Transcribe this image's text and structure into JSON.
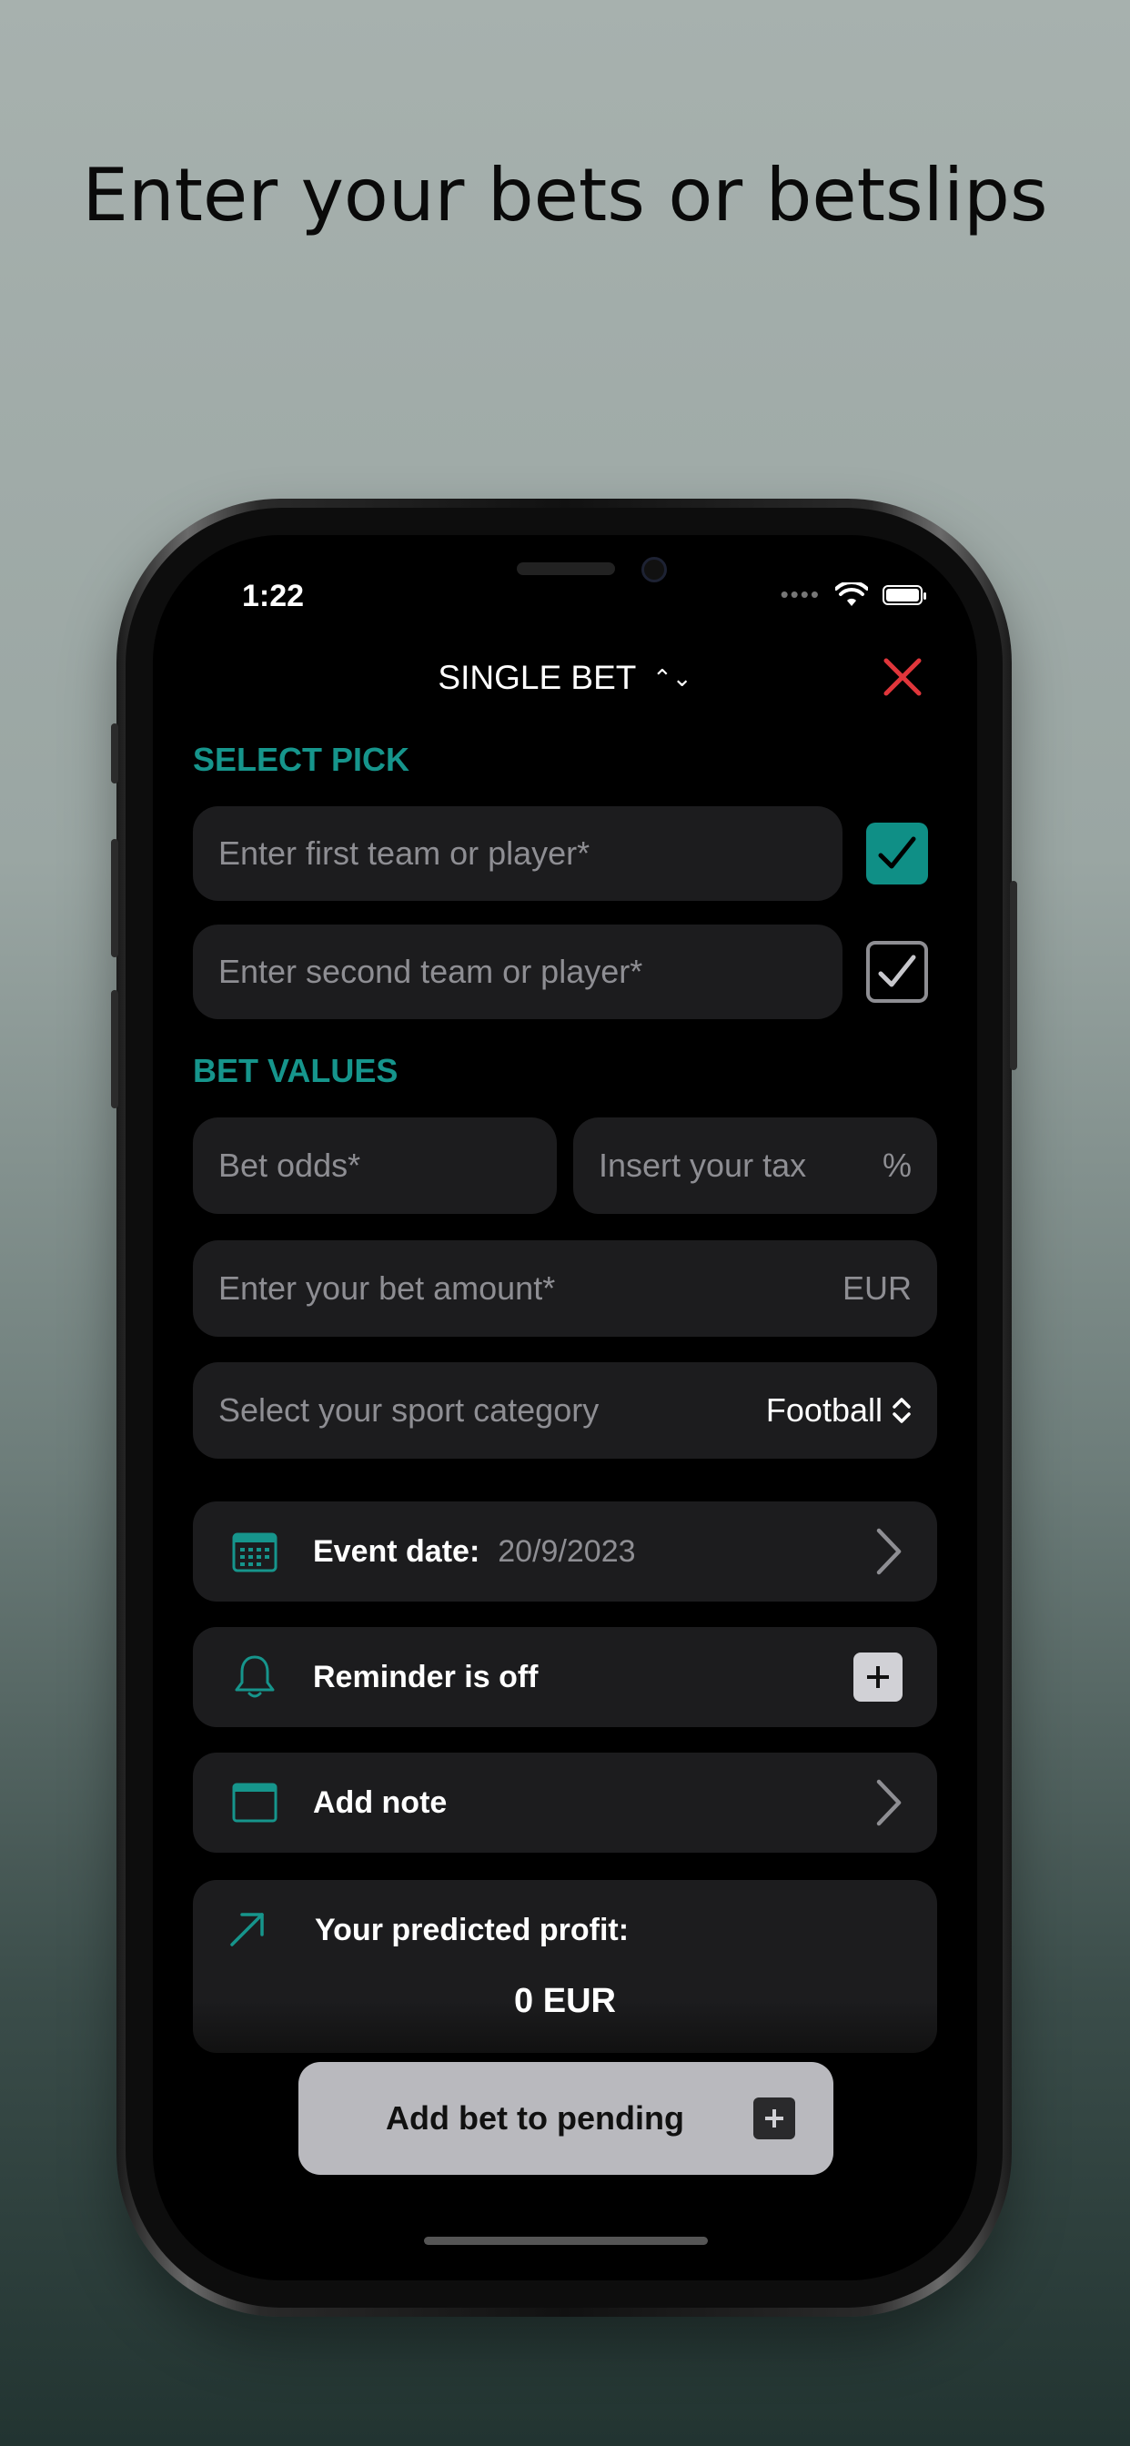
{
  "headline": "Enter your bets or betslips",
  "status": {
    "time": "1:22"
  },
  "nav": {
    "title": "SINGLE BET",
    "title_chevron": "⌃⌄"
  },
  "select_pick": {
    "label": "SELECT PICK",
    "first_placeholder": "Enter first team or player*",
    "second_placeholder": "Enter second team or player*",
    "first_checked": true,
    "second_checked": false
  },
  "bet_values": {
    "label": "BET VALUES",
    "odds_placeholder": "Bet odds*",
    "tax_placeholder": "Insert your tax",
    "tax_suffix": "%",
    "amount_placeholder": "Enter your bet amount*",
    "amount_suffix": "EUR",
    "category_placeholder": "Select your sport category",
    "category_value": "Football"
  },
  "rows": {
    "event_date_label": "Event date:",
    "event_date_value": "20/9/2023",
    "reminder_label": "Reminder is off",
    "note_label": "Add note"
  },
  "profit": {
    "label": "Your predicted profit:",
    "value": "0 EUR"
  },
  "cta": {
    "label": "Add bet to pending"
  },
  "colors": {
    "accent": "#16958c",
    "close": "#e0363b",
    "background": "#000000",
    "card": "#1c1c1e"
  },
  "icons": [
    "calendar-icon",
    "bell-icon",
    "note-icon",
    "trend-arrow-icon",
    "close-icon",
    "checkmark-icon",
    "plus-icon",
    "chevron-right-icon"
  ]
}
